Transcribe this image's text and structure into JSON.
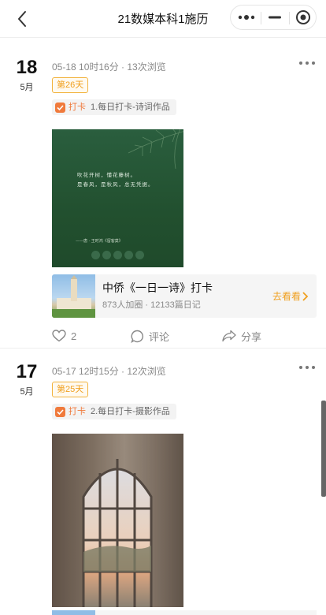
{
  "header": {
    "title": "21数媒本科1施历",
    "back_icon": "chevron-left-icon",
    "menu_icon": "more-dots-icon",
    "minimize_icon": "minus-icon",
    "close_icon": "target-circle-icon"
  },
  "posts": [
    {
      "day": "18",
      "month": "5月",
      "meta": "05-18 10时16分 · 13次浏览",
      "day_badge": "第26天",
      "tag_name": "打卡",
      "tag_text": "1.每日打卡-诗词作品",
      "poem_lines": [
        "吹花开树，懂花藤树。",
        "是春风，是秋风，总无凭据。"
      ],
      "poem_sig": "——唐 · 王时鸿《留客莫》",
      "card": {
        "title": "中侨《一日一诗》打卡",
        "stats": "873人加圈 · 12133篇日记",
        "go_label": "去看看"
      },
      "actions": {
        "like_count": "2",
        "comment_label": "评论",
        "share_label": "分享"
      }
    },
    {
      "day": "17",
      "month": "5月",
      "meta": "05-17 12时15分 · 12次浏览",
      "day_badge": "第25天",
      "tag_name": "打卡",
      "tag_text": "2.每日打卡-摄影作品"
    }
  ],
  "colors": {
    "accent": "#f0a020",
    "tag_orange": "#f07a3c",
    "poem_bg": "#22502f"
  }
}
